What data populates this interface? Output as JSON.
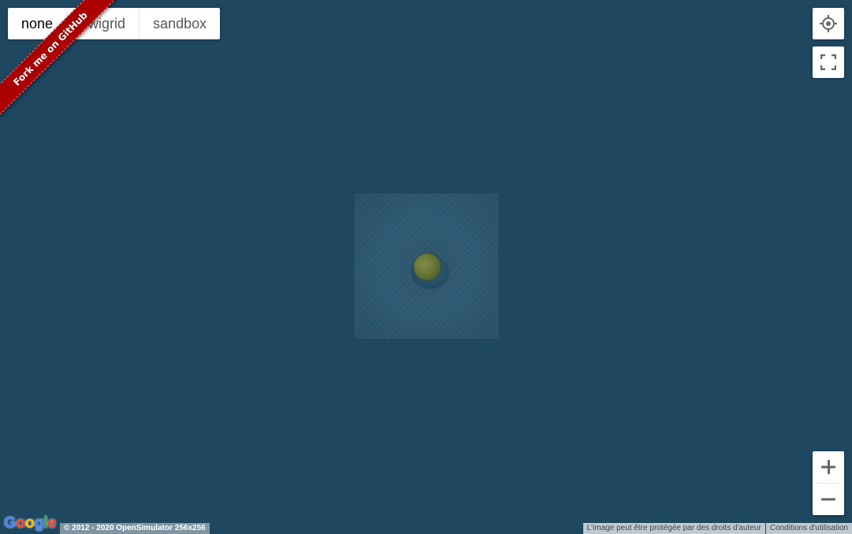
{
  "map": {
    "background_color": "#1f4760",
    "region_tile": {
      "island_color": "#6e7b3b"
    }
  },
  "map_type_control": {
    "buttons": [
      {
        "label": "none",
        "active": true
      },
      {
        "label": "owigrid",
        "active": false
      },
      {
        "label": "sandbox",
        "active": false
      }
    ]
  },
  "ribbon": {
    "label": "Fork me on GitHub",
    "color": "#aa0000"
  },
  "controls": {
    "locate_icon": "crosshair-icon",
    "fullscreen_icon": "fullscreen-icon",
    "zoom_in_label": "+",
    "zoom_out_label": "−"
  },
  "footer": {
    "google_logo": "Google",
    "copyright": "© 2012 - 2020 OpenSimulator 256x256",
    "image_rights": "L'image peut être protégée par des droits d'auteur",
    "terms": "Conditions d'utilisation"
  }
}
